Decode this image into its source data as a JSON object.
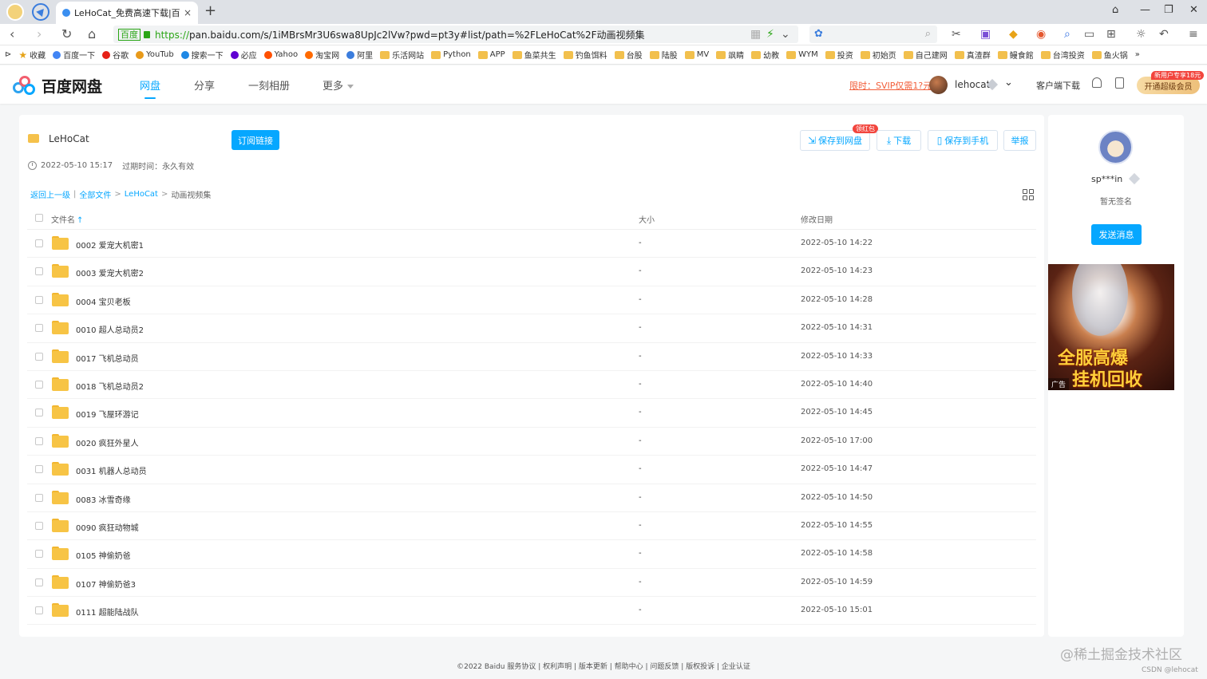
{
  "browser": {
    "tab_title": "LeHoCat_免费高速下载|百度网",
    "tab_close": "×",
    "new_tab": "+",
    "address": {
      "badge": "百度",
      "scheme": "https://",
      "url_rest": "pan.baidu.com/s/1iMBrsMr3U6swa8UpJc2lVw?pwd=pt3y#list/path=%2FLeHoCat%2F动画视频集"
    },
    "bookmarks": [
      {
        "label": "收藏",
        "icon": "star-icon"
      },
      {
        "label": "百度一下",
        "icon": "baidu-icon"
      },
      {
        "label": "谷歌",
        "icon": "google-icon"
      },
      {
        "label": "YouTub",
        "icon": "youtube-icon"
      },
      {
        "label": "搜索一下",
        "icon": "search-icon"
      },
      {
        "label": "必应",
        "icon": "bing-icon"
      },
      {
        "label": "Yahoo",
        "icon": "yahoo-icon"
      },
      {
        "label": "淘宝网",
        "icon": "taobao-icon"
      },
      {
        "label": "阿里",
        "icon": "ali-icon"
      },
      {
        "label": "乐活网站",
        "icon": "folder-icon"
      },
      {
        "label": "Python",
        "icon": "folder-icon"
      },
      {
        "label": "APP",
        "icon": "folder-icon"
      },
      {
        "label": "鱼菜共生",
        "icon": "folder-icon"
      },
      {
        "label": "钓鱼饵料",
        "icon": "folder-icon"
      },
      {
        "label": "台股",
        "icon": "folder-icon"
      },
      {
        "label": "陆股",
        "icon": "folder-icon"
      },
      {
        "label": "MV",
        "icon": "folder-icon"
      },
      {
        "label": "飒睛",
        "icon": "folder-icon"
      },
      {
        "label": "幼教",
        "icon": "folder-icon"
      },
      {
        "label": "WYM",
        "icon": "folder-icon"
      },
      {
        "label": "投资",
        "icon": "folder-icon"
      },
      {
        "label": "初始页",
        "icon": "folder-icon"
      },
      {
        "label": "自己建网",
        "icon": "folder-icon"
      },
      {
        "label": "真渣群",
        "icon": "folder-icon"
      },
      {
        "label": "鳗食館",
        "icon": "folder-icon"
      },
      {
        "label": "台湾投资",
        "icon": "folder-icon"
      },
      {
        "label": "鱼火锅",
        "icon": "folder-icon"
      }
    ],
    "bookmarks_more": "»"
  },
  "header": {
    "logo_text": "百度网盘",
    "nav": {
      "netdisk": "网盘",
      "share": "分享",
      "album": "一刻相册",
      "more": "更多"
    },
    "svip_promo": "限时：SVIP仅需1?元",
    "username": "lehocat",
    "client_download": "客户端下载",
    "vip_tag": "新用户专享18元",
    "vip_button": "开通超级会员"
  },
  "share": {
    "title": "LeHoCat",
    "subscribe_label": "订阅链接",
    "created": "2022-05-10 15:17",
    "expiry": "过期时间：永久有效",
    "actions": {
      "save_to_disk": "保存到网盘",
      "redpacket": "领红包",
      "download": "下载",
      "save_to_phone": "保存到手机",
      "report": "举报"
    }
  },
  "breadcrumb": {
    "back": "返回上一级",
    "all_files": "全部文件",
    "sep": ">",
    "folder": "LeHoCat",
    "current": "动画视频集"
  },
  "table": {
    "col_name": "文件名",
    "col_size": "大小",
    "col_date": "修改日期",
    "sort_arrow": "↑",
    "rows": [
      {
        "name": "0002 爱宠大机密1",
        "size": "-",
        "date": "2022-05-10 14:22"
      },
      {
        "name": "0003 爱宠大机密2",
        "size": "-",
        "date": "2022-05-10 14:23"
      },
      {
        "name": "0004 宝贝老板",
        "size": "-",
        "date": "2022-05-10 14:28"
      },
      {
        "name": "0010 超人总动员2",
        "size": "-",
        "date": "2022-05-10 14:31"
      },
      {
        "name": "0017 飞机总动员",
        "size": "-",
        "date": "2022-05-10 14:33"
      },
      {
        "name": "0018 飞机总动员2",
        "size": "-",
        "date": "2022-05-10 14:40"
      },
      {
        "name": "0019 飞屋环游记",
        "size": "-",
        "date": "2022-05-10 14:45"
      },
      {
        "name": "0020 疯狂外星人",
        "size": "-",
        "date": "2022-05-10 17:00"
      },
      {
        "name": "0031 机器人总动员",
        "size": "-",
        "date": "2022-05-10 14:47"
      },
      {
        "name": "0083 冰雪奇缘",
        "size": "-",
        "date": "2022-05-10 14:50"
      },
      {
        "name": "0090 疯狂动物城",
        "size": "-",
        "date": "2022-05-10 14:55"
      },
      {
        "name": "0105 神偷奶爸",
        "size": "-",
        "date": "2022-05-10 14:58"
      },
      {
        "name": "0107 神偷奶爸3",
        "size": "-",
        "date": "2022-05-10 14:59"
      },
      {
        "name": "0111 超能陆战队",
        "size": "-",
        "date": "2022-05-10 15:01"
      }
    ]
  },
  "sidebar": {
    "sharer_name": "sp***in",
    "signature": "暂无签名",
    "send_message": "发送消息",
    "ad_line1": "全服高爆",
    "ad_line2": "挂机回收",
    "ad_badge": "广告"
  },
  "footer": {
    "text": "©2022 Baidu  服务协议 | 权利声明 | 版本更新 | 帮助中心 | 问题反馈 | 版权投诉 | 企业认证"
  },
  "watermark": "@稀土掘金技术社区",
  "csdn_mark": "CSDN @lehocat",
  "colors": {
    "accent": "#06a7ff",
    "folder": "#f7c445",
    "promo": "#f25e3a"
  }
}
